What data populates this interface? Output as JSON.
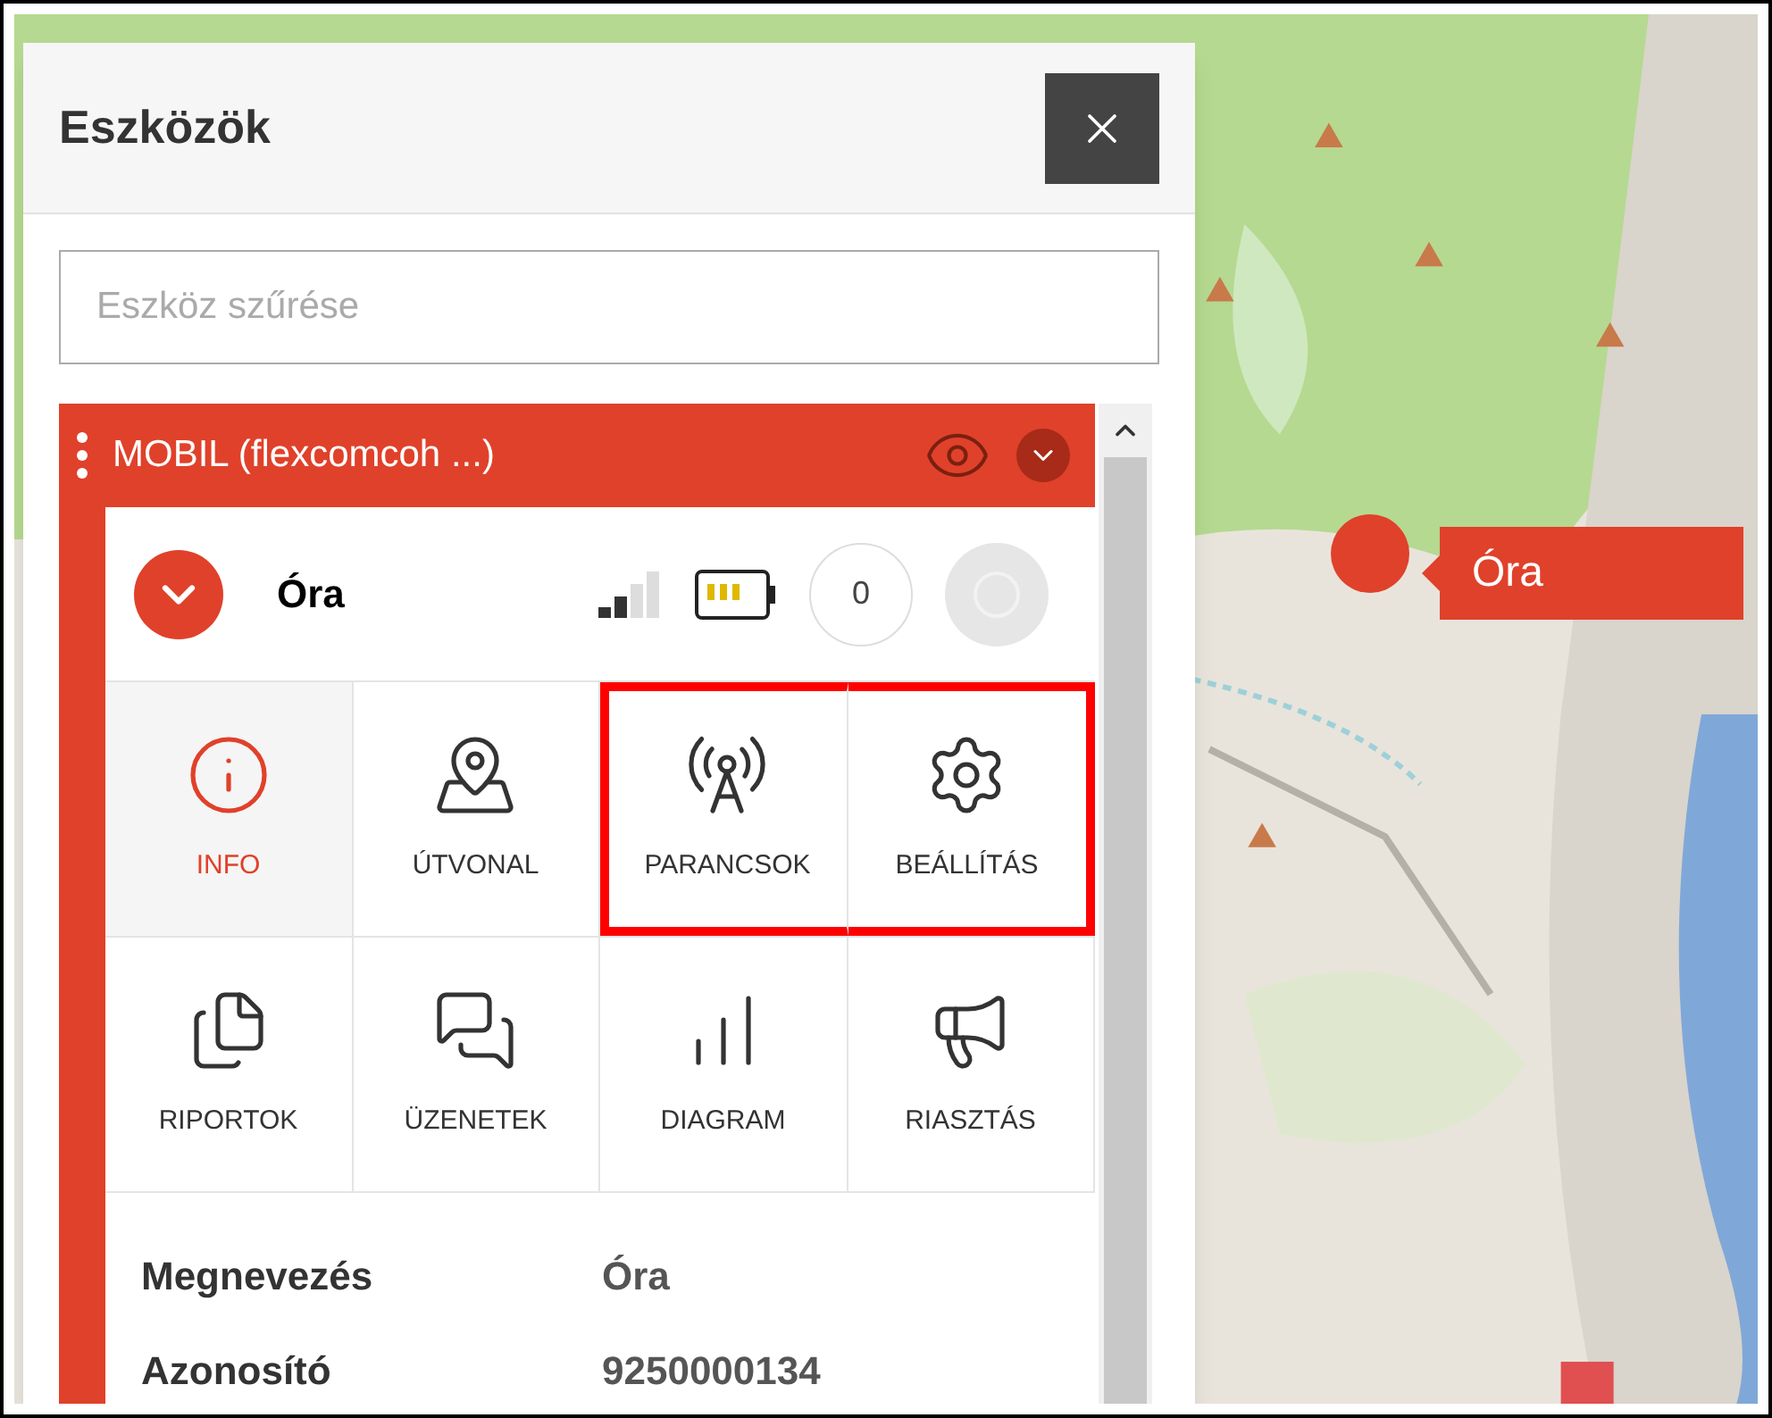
{
  "panel": {
    "title": "Eszközök",
    "search": {
      "placeholder": "Eszköz szűrése"
    },
    "group": {
      "name": "MOBIL (flexcomcoh ...)",
      "expanded": true
    },
    "device": {
      "name": "Óra",
      "expanded": true,
      "counter": "0"
    },
    "tiles": [
      {
        "label": "INFO",
        "kind": "info",
        "selected": true,
        "highlighted": false
      },
      {
        "label": "ÚTVONAL",
        "kind": "route",
        "selected": false,
        "highlighted": false
      },
      {
        "label": "PARANCSOK",
        "kind": "commands",
        "selected": false,
        "highlighted": true
      },
      {
        "label": "BEÁLLÍTÁS",
        "kind": "settings",
        "selected": false,
        "highlighted": true
      },
      {
        "label": "RIPORTOK",
        "kind": "reports",
        "selected": false,
        "highlighted": false
      },
      {
        "label": "ÜZENETEK",
        "kind": "messages",
        "selected": false,
        "highlighted": false
      },
      {
        "label": "DIAGRAM",
        "kind": "diagram",
        "selected": false,
        "highlighted": false
      },
      {
        "label": "RIASZTÁS",
        "kind": "alarm",
        "selected": false,
        "highlighted": false
      }
    ],
    "details": [
      {
        "label": "Megnevezés",
        "value": "Óra"
      },
      {
        "label": "Azonosító",
        "value": "9250000134"
      }
    ]
  },
  "map": {
    "marker": {
      "label": "Óra"
    }
  }
}
